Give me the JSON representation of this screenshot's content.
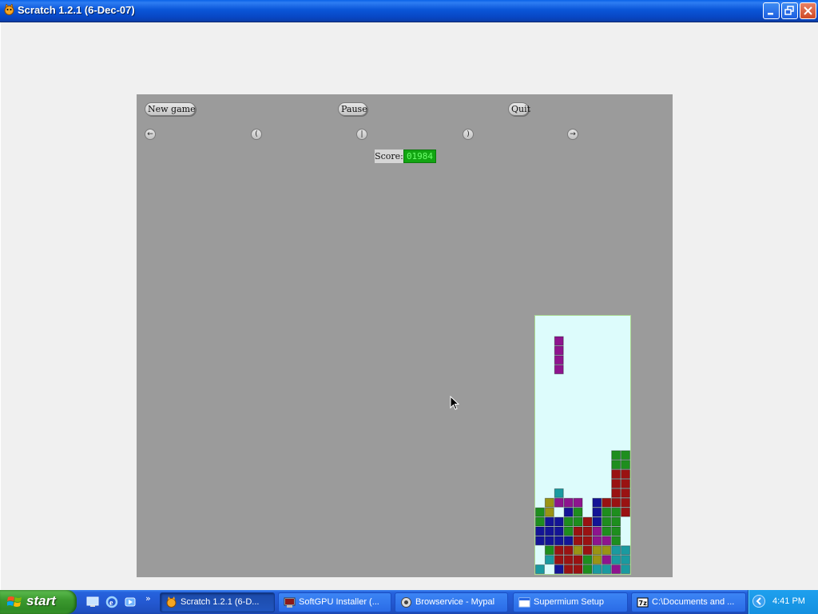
{
  "window": {
    "title": "Scratch 1.2.1 (6-Dec-07)",
    "icon": "scratch-cat-icon"
  },
  "stage": {
    "buttons": {
      "new_game": "New game",
      "pause": "Pause",
      "quit": "Quit"
    },
    "controls": {
      "left": "←",
      "rotate_left": "(",
      "drop": "|",
      "rotate_right": ")",
      "right": "→"
    },
    "score": {
      "label": "Score:",
      "value": "01984"
    }
  },
  "board": {
    "colors": {
      "G": "#1e8e1e",
      "R": "#9a1212",
      "B": "#141496",
      "P": "#8e148e",
      "Y": "#9a9414",
      "C": "#1a9aa0"
    },
    "falling_piece": {
      "color": "P",
      "column": 2,
      "rows": [
        2,
        3,
        4,
        5
      ]
    },
    "rows": [
      "..........",
      "..........",
      "..........",
      "..........",
      "..........",
      "..........",
      "..........",
      "..........",
      "..........",
      "..........",
      "..........",
      "..........",
      "..........",
      "..........",
      "........GG",
      "........GG",
      "........RR",
      "........RR",
      "..C.....RR",
      ".YPPP.BRRR",
      "GY.BG.BGGR",
      "GBBGGRBGG.",
      "BBBGRRPGG.",
      "BBBBRRPPG.",
      ".GRRYRYYCC",
      ".CRRRGYPCC",
      "C.BRRGCCPC"
    ]
  },
  "taskbar": {
    "start_label": "start",
    "quick_launch": [
      "desktop-icon",
      "ie-icon",
      "media-icon"
    ],
    "chevron": "»",
    "tasks": [
      {
        "label": "Scratch 1.2.1 (6-D...",
        "icon": "scratch-cat-icon",
        "active": true
      },
      {
        "label": "SoftGPU Installer (...",
        "icon": "installer-icon",
        "active": false
      },
      {
        "label": "Browservice - Mypal",
        "icon": "mypal-icon",
        "active": false
      },
      {
        "label": "Supermium Setup",
        "icon": "window-icon",
        "active": false
      },
      {
        "label": "C:\\Documents and ...",
        "icon": "7zip-icon",
        "active": false
      }
    ],
    "clock": "4:41 PM"
  }
}
